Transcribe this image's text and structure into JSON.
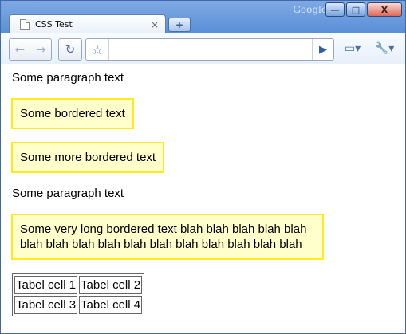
{
  "window": {
    "brand": "Google",
    "buttons": {
      "minimize": "—",
      "maximize": "□",
      "close": "X"
    }
  },
  "tab": {
    "title": "CSS Test",
    "close": "×",
    "new_tab": "+"
  },
  "toolbar": {
    "back_icon": "←",
    "forward_icon": "→",
    "reload_icon": "↻",
    "star_icon": "☆",
    "go_icon": "▶",
    "page_menu_icon": "▭▾",
    "wrench_menu_icon": "🔧▾"
  },
  "omnibox": {
    "value": ""
  },
  "content": {
    "paragraph_1": "Some paragraph text",
    "bordered_1": "Some bordered text",
    "bordered_2": "Some more bordered text",
    "paragraph_2": "Some paragraph text",
    "bordered_3": "Some very long bordered text blah blah blah blah blah blah blah blah blah blah blah blah blah blah blah blah",
    "table": {
      "rows": [
        [
          "Tabel cell 1",
          "Tabel cell 2"
        ],
        [
          "Tabel cell 3",
          "Tabel cell 4"
        ]
      ]
    }
  }
}
